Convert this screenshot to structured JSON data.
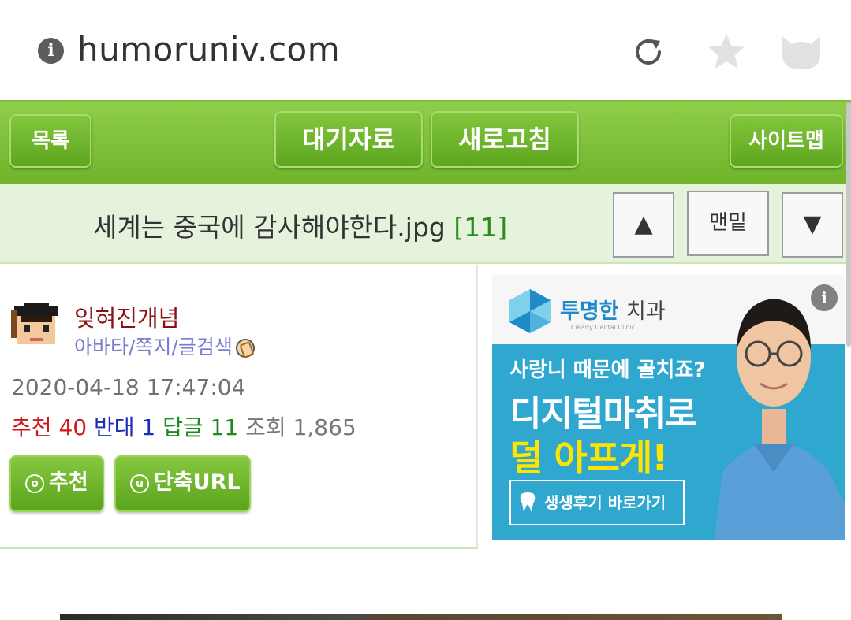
{
  "browser": {
    "url": "humoruniv.com"
  },
  "nav": {
    "list_label": "목록",
    "waiting_label": "대기자료",
    "refresh_label": "새로고침",
    "sitemap_label": "사이트맵"
  },
  "post": {
    "title": "세계는 중국에 감사해야한다.jpg",
    "comment_count": "[11]",
    "up_label": "▲",
    "bottom_label": "맨밑",
    "down_label": "▼"
  },
  "author": {
    "nickname": "잊혀진개념",
    "links": "아바타/쪽지/글검색",
    "date": "2020-04-18 17:47:04",
    "recommend_label": "추천",
    "recommend_value": "40",
    "oppose_label": "반대",
    "oppose_value": "1",
    "reply_label": "답글",
    "reply_value": "11",
    "view_label": "조회",
    "view_value": "1,865",
    "like_button": "추천",
    "like_icon": "o",
    "short_url_button": "단축URL",
    "short_url_icon": "u"
  },
  "ad": {
    "brand": "투명한",
    "brand_sub": "치과",
    "brand_tiny": "Clearly Dental Clinic",
    "line1": "사랑니 때문에 골치죠?",
    "line2": "디지털마취로",
    "line3": "덜 아프게!",
    "cta": "생생후기 바로가기",
    "info": "i"
  },
  "colors": {
    "nav_green": "#6fb42a",
    "title_bg": "#e6f3dc",
    "ad_blue": "#2fa7cf",
    "recommend_red": "#d01818",
    "oppose_blue": "#1a2fb8",
    "reply_green": "#1c8a1c"
  }
}
